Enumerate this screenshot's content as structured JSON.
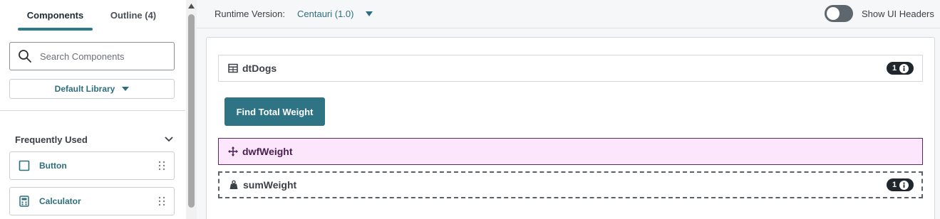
{
  "left_panel": {
    "tabs": [
      {
        "label": "Components",
        "active": true
      },
      {
        "label": "Outline (4)",
        "active": false
      }
    ],
    "search": {
      "placeholder": "Search Components",
      "value": ""
    },
    "library_select": {
      "label": "Default Library"
    },
    "section": {
      "title": "Frequently Used",
      "expanded": true
    },
    "components": [
      {
        "label": "Button",
        "icon": "square-outline-icon"
      },
      {
        "label": "Calculator",
        "icon": "calculator-icon"
      }
    ]
  },
  "topbar": {
    "runtime_label": "Runtime Version:",
    "runtime_value": "Centauri (1.0)",
    "toggle_label": "Show UI Headers",
    "toggle_on": false
  },
  "canvas": {
    "rows": [
      {
        "label": "dtDogs",
        "icon": "table-icon",
        "badge": "1"
      },
      {
        "label": "dwfWeight",
        "icon": "move-icon",
        "selected": true
      },
      {
        "label": "sumWeight",
        "icon": "weight-icon",
        "badge": "1"
      }
    ],
    "button": {
      "label": "Find Total Weight"
    }
  },
  "colors": {
    "accent": "#2f7485",
    "link": "#2d6e7d",
    "selected_bg": "#fbe6fb",
    "selected_border": "#5a2a5e",
    "badge_bg": "#1f262c"
  }
}
